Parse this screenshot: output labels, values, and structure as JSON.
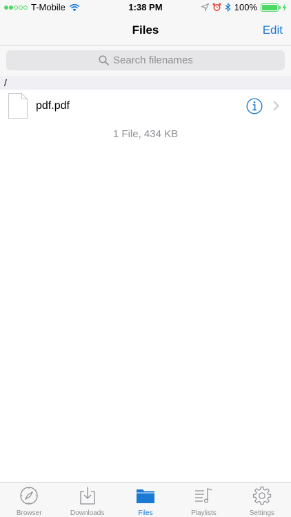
{
  "status_bar": {
    "carrier": "T-Mobile",
    "time": "1:38 PM",
    "battery_text": "100%",
    "battery_level": 1.0,
    "signal_bars_filled": 2,
    "signal_bars_total": 5
  },
  "nav": {
    "title": "Files",
    "edit_label": "Edit"
  },
  "search": {
    "placeholder": "Search filenames"
  },
  "path": "/",
  "files": [
    {
      "name": "pdf.pdf"
    }
  ],
  "summary": "1 File, 434 KB",
  "tabs": [
    {
      "label": "Browser",
      "icon": "compass-icon",
      "active": false
    },
    {
      "label": "Downloads",
      "icon": "download-tray-icon",
      "active": false
    },
    {
      "label": "Files",
      "icon": "folder-icon",
      "active": true
    },
    {
      "label": "Playlists",
      "icon": "playlist-icon",
      "active": false
    },
    {
      "label": "Settings",
      "icon": "gear-icon",
      "active": false
    }
  ],
  "colors": {
    "accent": "#1a7ad4",
    "battery": "#4cd964",
    "inactive_tab": "#8e8e93"
  }
}
